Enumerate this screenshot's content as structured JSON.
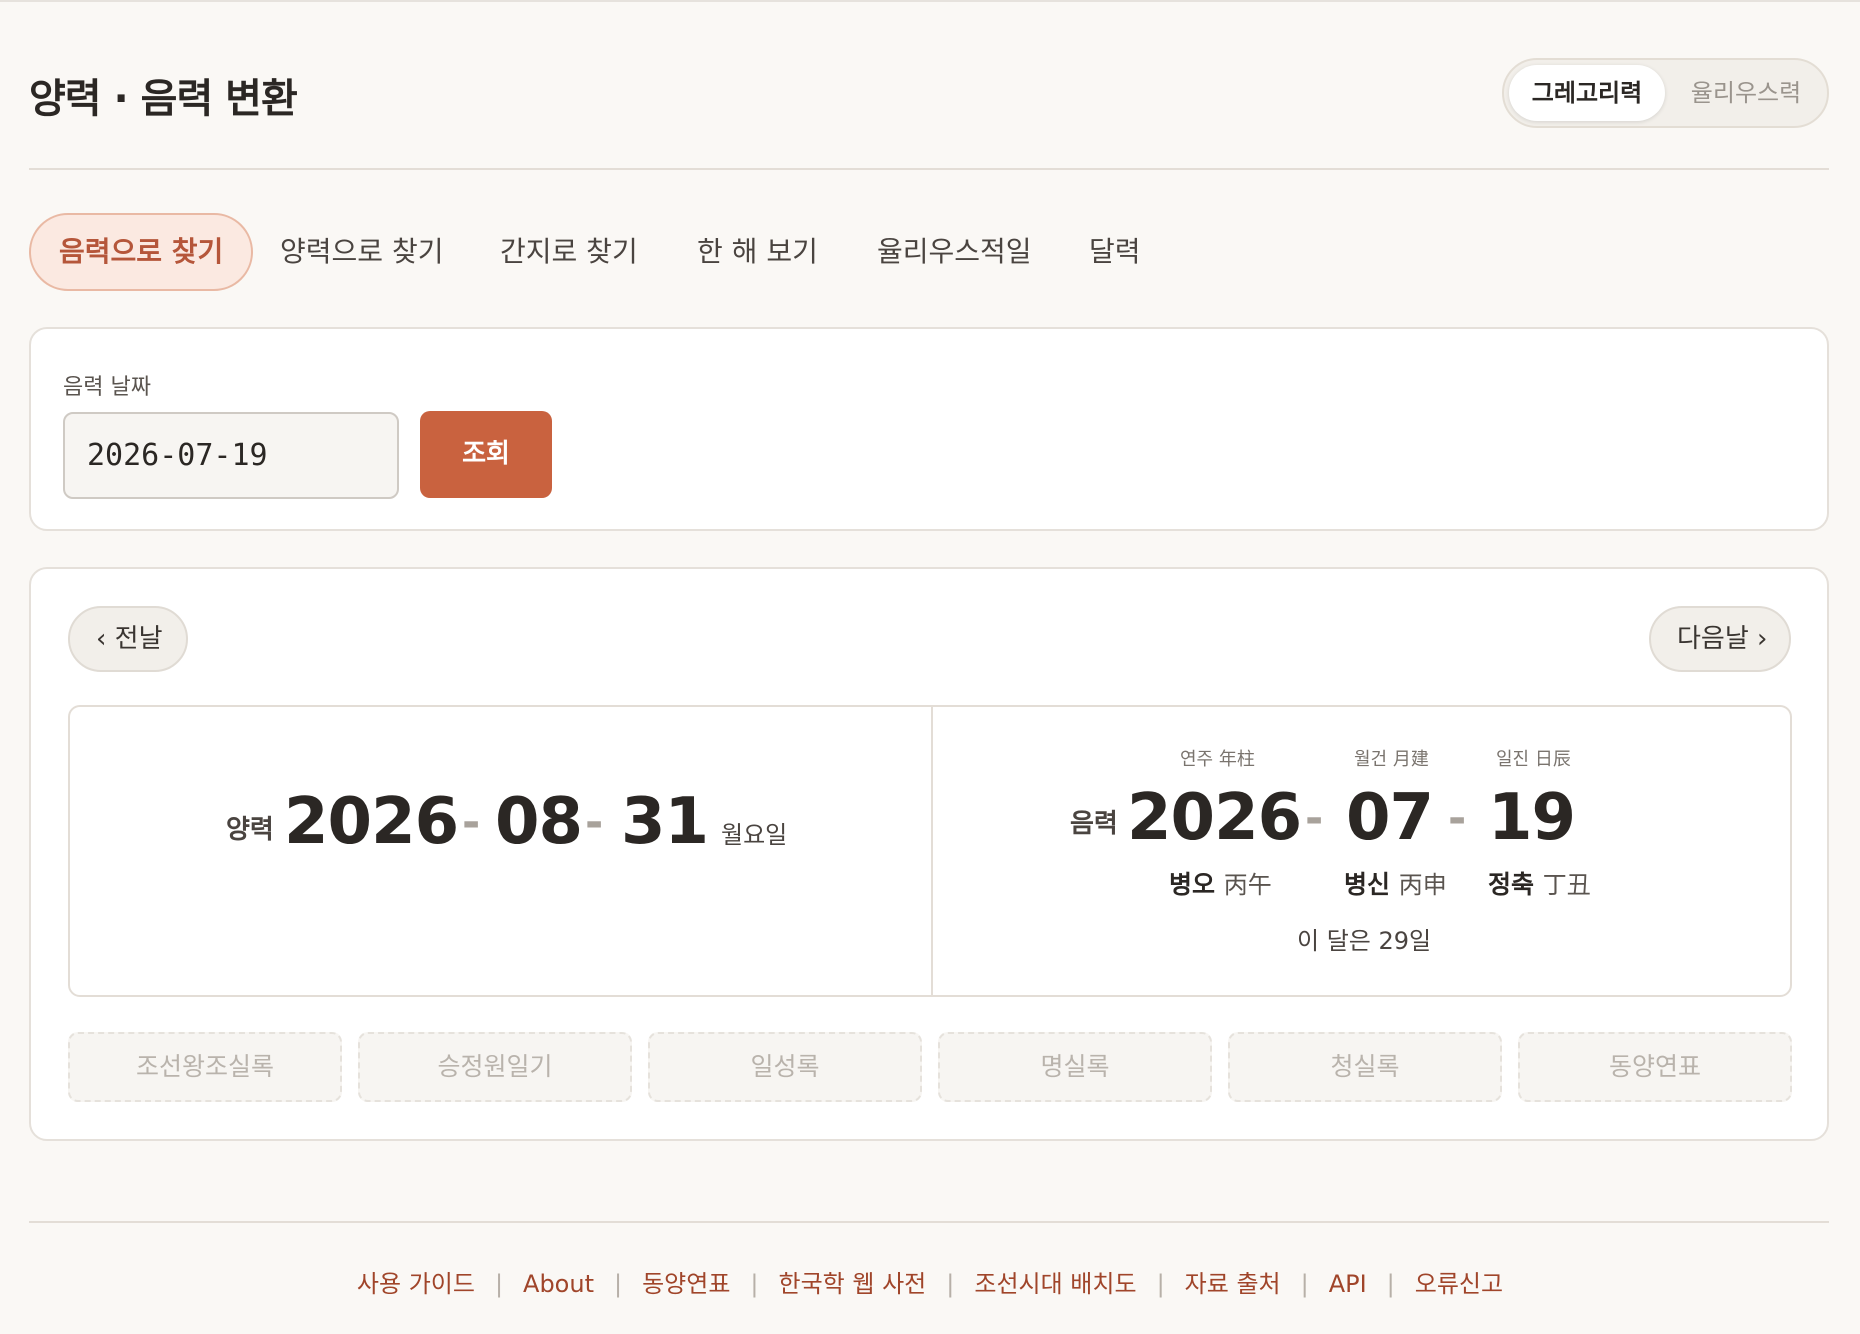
{
  "app": {
    "title": "양력 · 음력 변환"
  },
  "calendar_system": {
    "options": [
      "그레고리력",
      "율리우스력"
    ],
    "selected": "그레고리력"
  },
  "tabs": [
    {
      "label": "음력으로 찾기",
      "active": true
    },
    {
      "label": "양력으로 찾기",
      "active": false
    },
    {
      "label": "간지로 찾기",
      "active": false
    },
    {
      "label": "한 해 보기",
      "active": false
    },
    {
      "label": "율리우스적일",
      "active": false
    },
    {
      "label": "달력",
      "active": false
    }
  ],
  "input": {
    "label": "음력 날짜",
    "value": "2026-07-19",
    "submit_label": "조회"
  },
  "nav": {
    "prev_label": "‹ 전날",
    "next_label": "다음날 ›"
  },
  "solar": {
    "label": "양력",
    "year": "2026",
    "month": "08",
    "day": "31",
    "weekday": "월요일",
    "separator": "-"
  },
  "lunar": {
    "label": "음력",
    "year": "2026",
    "month": "07",
    "day": "19",
    "year_head": "연주 年柱",
    "month_head": "월건 月建",
    "day_head": "일진 日辰",
    "year_ganji": "병오",
    "year_hanja": "丙午",
    "month_ganji": "병신",
    "month_hanja": "丙申",
    "day_ganji": "정축",
    "day_hanja": "丁丑",
    "month_days": "이 달은 29일"
  },
  "sources": [
    "조선왕조실록",
    "승정원일기",
    "일성록",
    "명실록",
    "청실록",
    "동양연표"
  ],
  "footer": {
    "links": [
      "사용 가이드",
      "About",
      "동양연표",
      "한국학 웹 사전",
      "조선시대 배치도",
      "자료 출처",
      "API",
      "오류신고"
    ],
    "separator": "|"
  },
  "colors": {
    "accent": "#c9623f",
    "link": "#a0452a",
    "active_tab_bg": "#fbe9e1",
    "background": "#faf8f5"
  }
}
